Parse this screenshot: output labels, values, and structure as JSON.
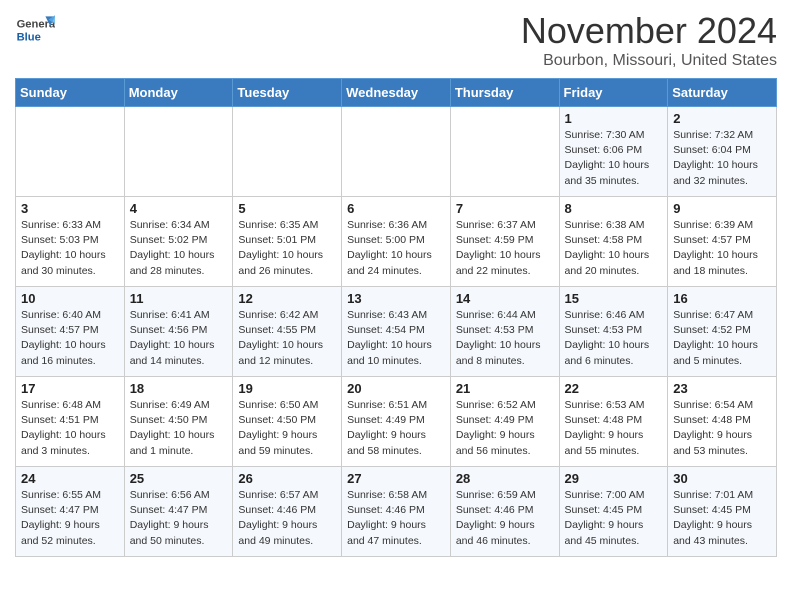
{
  "header": {
    "logo": {
      "general": "General",
      "blue": "Blue"
    },
    "month": "November 2024",
    "location": "Bourbon, Missouri, United States"
  },
  "weekdays": [
    "Sunday",
    "Monday",
    "Tuesday",
    "Wednesday",
    "Thursday",
    "Friday",
    "Saturday"
  ],
  "weeks": [
    [
      {
        "day": "",
        "info": ""
      },
      {
        "day": "",
        "info": ""
      },
      {
        "day": "",
        "info": ""
      },
      {
        "day": "",
        "info": ""
      },
      {
        "day": "",
        "info": ""
      },
      {
        "day": "1",
        "info": "Sunrise: 7:30 AM\nSunset: 6:06 PM\nDaylight: 10 hours\nand 35 minutes."
      },
      {
        "day": "2",
        "info": "Sunrise: 7:32 AM\nSunset: 6:04 PM\nDaylight: 10 hours\nand 32 minutes."
      }
    ],
    [
      {
        "day": "3",
        "info": "Sunrise: 6:33 AM\nSunset: 5:03 PM\nDaylight: 10 hours\nand 30 minutes."
      },
      {
        "day": "4",
        "info": "Sunrise: 6:34 AM\nSunset: 5:02 PM\nDaylight: 10 hours\nand 28 minutes."
      },
      {
        "day": "5",
        "info": "Sunrise: 6:35 AM\nSunset: 5:01 PM\nDaylight: 10 hours\nand 26 minutes."
      },
      {
        "day": "6",
        "info": "Sunrise: 6:36 AM\nSunset: 5:00 PM\nDaylight: 10 hours\nand 24 minutes."
      },
      {
        "day": "7",
        "info": "Sunrise: 6:37 AM\nSunset: 4:59 PM\nDaylight: 10 hours\nand 22 minutes."
      },
      {
        "day": "8",
        "info": "Sunrise: 6:38 AM\nSunset: 4:58 PM\nDaylight: 10 hours\nand 20 minutes."
      },
      {
        "day": "9",
        "info": "Sunrise: 6:39 AM\nSunset: 4:57 PM\nDaylight: 10 hours\nand 18 minutes."
      }
    ],
    [
      {
        "day": "10",
        "info": "Sunrise: 6:40 AM\nSunset: 4:57 PM\nDaylight: 10 hours\nand 16 minutes."
      },
      {
        "day": "11",
        "info": "Sunrise: 6:41 AM\nSunset: 4:56 PM\nDaylight: 10 hours\nand 14 minutes."
      },
      {
        "day": "12",
        "info": "Sunrise: 6:42 AM\nSunset: 4:55 PM\nDaylight: 10 hours\nand 12 minutes."
      },
      {
        "day": "13",
        "info": "Sunrise: 6:43 AM\nSunset: 4:54 PM\nDaylight: 10 hours\nand 10 minutes."
      },
      {
        "day": "14",
        "info": "Sunrise: 6:44 AM\nSunset: 4:53 PM\nDaylight: 10 hours\nand 8 minutes."
      },
      {
        "day": "15",
        "info": "Sunrise: 6:46 AM\nSunset: 4:53 PM\nDaylight: 10 hours\nand 6 minutes."
      },
      {
        "day": "16",
        "info": "Sunrise: 6:47 AM\nSunset: 4:52 PM\nDaylight: 10 hours\nand 5 minutes."
      }
    ],
    [
      {
        "day": "17",
        "info": "Sunrise: 6:48 AM\nSunset: 4:51 PM\nDaylight: 10 hours\nand 3 minutes."
      },
      {
        "day": "18",
        "info": "Sunrise: 6:49 AM\nSunset: 4:50 PM\nDaylight: 10 hours\nand 1 minute."
      },
      {
        "day": "19",
        "info": "Sunrise: 6:50 AM\nSunset: 4:50 PM\nDaylight: 9 hours\nand 59 minutes."
      },
      {
        "day": "20",
        "info": "Sunrise: 6:51 AM\nSunset: 4:49 PM\nDaylight: 9 hours\nand 58 minutes."
      },
      {
        "day": "21",
        "info": "Sunrise: 6:52 AM\nSunset: 4:49 PM\nDaylight: 9 hours\nand 56 minutes."
      },
      {
        "day": "22",
        "info": "Sunrise: 6:53 AM\nSunset: 4:48 PM\nDaylight: 9 hours\nand 55 minutes."
      },
      {
        "day": "23",
        "info": "Sunrise: 6:54 AM\nSunset: 4:48 PM\nDaylight: 9 hours\nand 53 minutes."
      }
    ],
    [
      {
        "day": "24",
        "info": "Sunrise: 6:55 AM\nSunset: 4:47 PM\nDaylight: 9 hours\nand 52 minutes."
      },
      {
        "day": "25",
        "info": "Sunrise: 6:56 AM\nSunset: 4:47 PM\nDaylight: 9 hours\nand 50 minutes."
      },
      {
        "day": "26",
        "info": "Sunrise: 6:57 AM\nSunset: 4:46 PM\nDaylight: 9 hours\nand 49 minutes."
      },
      {
        "day": "27",
        "info": "Sunrise: 6:58 AM\nSunset: 4:46 PM\nDaylight: 9 hours\nand 47 minutes."
      },
      {
        "day": "28",
        "info": "Sunrise: 6:59 AM\nSunset: 4:46 PM\nDaylight: 9 hours\nand 46 minutes."
      },
      {
        "day": "29",
        "info": "Sunrise: 7:00 AM\nSunset: 4:45 PM\nDaylight: 9 hours\nand 45 minutes."
      },
      {
        "day": "30",
        "info": "Sunrise: 7:01 AM\nSunset: 4:45 PM\nDaylight: 9 hours\nand 43 minutes."
      }
    ]
  ]
}
